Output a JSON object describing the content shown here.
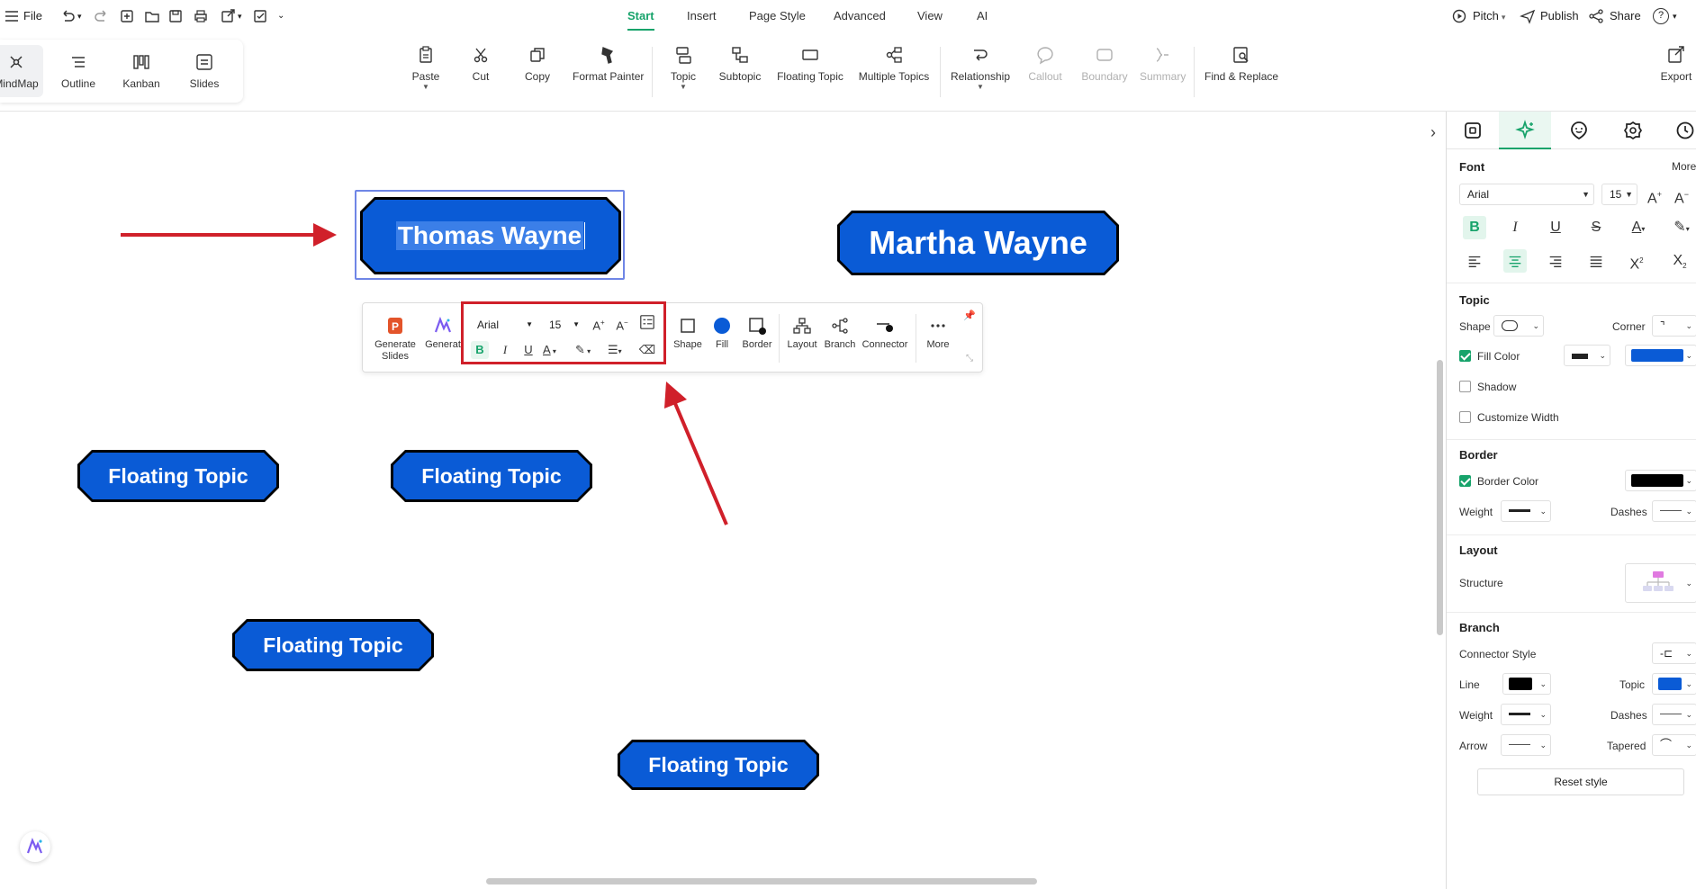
{
  "menubar": {
    "file_label": "File",
    "tabs": [
      {
        "label": "Start",
        "active": true
      },
      {
        "label": "Insert",
        "active": false
      },
      {
        "label": "Page Style",
        "active": false
      },
      {
        "label": "Advanced",
        "active": false
      },
      {
        "label": "View",
        "active": false
      },
      {
        "label": "AI",
        "active": false
      }
    ],
    "pitch_label": "Pitch",
    "publish_label": "Publish",
    "share_label": "Share",
    "help_label": "?"
  },
  "viewmodes": [
    {
      "label": "MindMap",
      "active": true,
      "icon": "mindmap-icon"
    },
    {
      "label": "Outline",
      "active": false,
      "icon": "outline-icon"
    },
    {
      "label": "Kanban",
      "active": false,
      "icon": "kanban-icon"
    },
    {
      "label": "Slides",
      "active": false,
      "icon": "slides-icon"
    }
  ],
  "ribbon": {
    "paste": "Paste",
    "cut": "Cut",
    "copy": "Copy",
    "format_painter": "Format Painter",
    "topic": "Topic",
    "subtopic": "Subtopic",
    "floating_topic": "Floating Topic",
    "multiple_topics": "Multiple Topics",
    "relationship": "Relationship",
    "callout": "Callout",
    "boundary": "Boundary",
    "summary": "Summary",
    "find_replace": "Find & Replace",
    "export": "Export"
  },
  "canvas": {
    "selected_topic": "Thomas Wayne",
    "other_topic": "Martha Wayne",
    "floating_topics": [
      "Floating Topic",
      "Floating Topic",
      "Floating Topic",
      "Floating Topic"
    ],
    "topic_fill_color": "#0a5bd6",
    "topic_border_color": "#000000",
    "annotation_color": "#d0202a"
  },
  "floatbar": {
    "generate_slides": "Generate Slides",
    "generate_cut": "Generat",
    "font": "Arial",
    "size": "15",
    "shape": "Shape",
    "fill": "Fill",
    "border": "Border",
    "layout": "Layout",
    "branch": "Branch",
    "connector": "Connector",
    "more": "More"
  },
  "panel": {
    "font_title": "Font",
    "more_label": "More",
    "font_name": "Arial",
    "font_size": "15",
    "topic_title": "Topic",
    "shape_label": "Shape",
    "corner_label": "Corner",
    "fill_color_label": "Fill Color",
    "fill_color_checked": true,
    "shadow_label": "Shadow",
    "shadow_checked": false,
    "customize_width_label": "Customize Width",
    "customize_width_checked": false,
    "border_title": "Border",
    "border_color_label": "Border Color",
    "border_color_checked": true,
    "weight_label": "Weight",
    "dashes_label": "Dashes",
    "layout_title": "Layout",
    "structure_label": "Structure",
    "branch_title": "Branch",
    "connector_style_label": "Connector Style",
    "line_label": "Line",
    "topic_label": "Topic",
    "branch_weight_label": "Weight",
    "branch_dashes_label": "Dashes",
    "arrow_label": "Arrow",
    "tapered_label": "Tapered",
    "reset_label": "Reset style",
    "fill_swatch_color": "#0a5bd6",
    "border_swatch_color": "#000000",
    "line_swatch_color": "#000000",
    "topic_swatch_color": "#0a5bd6"
  }
}
